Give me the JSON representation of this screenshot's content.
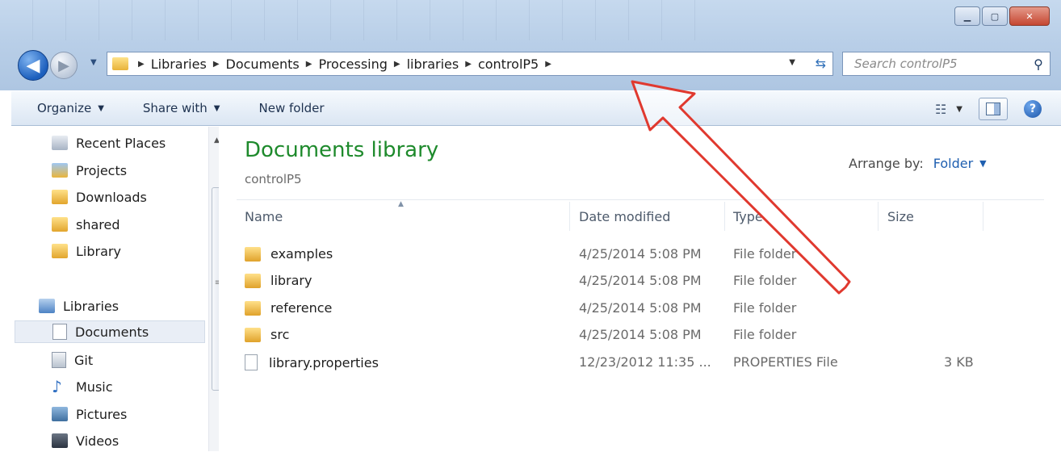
{
  "address": {
    "crumbs": [
      "Libraries",
      "Documents",
      "Processing",
      "libraries",
      "controlP5"
    ]
  },
  "search": {
    "placeholder": "Search controlP5"
  },
  "toolbar": {
    "organize": "Organize",
    "share_with": "Share with",
    "new_folder": "New folder"
  },
  "nav": {
    "favorites": [
      "Recent Places",
      "Projects",
      "Downloads",
      "shared",
      "Library"
    ],
    "libraries_label": "Libraries",
    "libraries": [
      "Documents",
      "Git",
      "Music",
      "Pictures",
      "Videos"
    ]
  },
  "content": {
    "title": "Documents library",
    "subtitle": "controlP5",
    "arrange_label": "Arrange by:",
    "arrange_value": "Folder",
    "columns": {
      "name": "Name",
      "date": "Date modified",
      "type": "Type",
      "size": "Size"
    },
    "files": [
      {
        "name": "examples",
        "date": "4/25/2014 5:08 PM",
        "type": "File folder",
        "size": ""
      },
      {
        "name": "library",
        "date": "4/25/2014 5:08 PM",
        "type": "File folder",
        "size": ""
      },
      {
        "name": "reference",
        "date": "4/25/2014 5:08 PM",
        "type": "File folder",
        "size": ""
      },
      {
        "name": "src",
        "date": "4/25/2014 5:08 PM",
        "type": "File folder",
        "size": ""
      },
      {
        "name": "library.properties",
        "date": "12/23/2012 11:35 ...",
        "type": "PROPERTIES File",
        "size": "3 KB"
      }
    ]
  },
  "colors": {
    "title_green": "#1e8a2c",
    "link_blue": "#1f5fb0",
    "annotation_arrow": "#e0392f"
  }
}
